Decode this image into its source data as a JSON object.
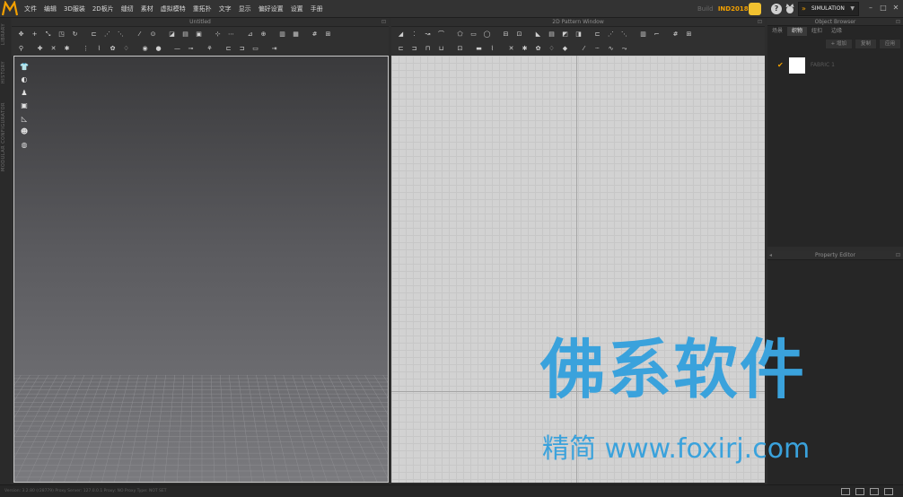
{
  "menubar": {
    "items": [
      "文件",
      "编辑",
      "3D服装",
      "2D板片",
      "缝纫",
      "素材",
      "虚拟模特",
      "重拓扑",
      "文字",
      "显示",
      "偏好设置",
      "设置",
      "手册"
    ],
    "build_label": "Build",
    "build_value": "IND2018",
    "mode": "SIMULATION",
    "help": "?"
  },
  "left_tabs": [
    "LIBRARY",
    "HISTORY",
    "MODULAR CONFIGURATOR"
  ],
  "window_3d": {
    "title": "Untitled"
  },
  "window_2d": {
    "title": "2D Pattern Window"
  },
  "object_browser": {
    "title": "Object Browser",
    "tabs": [
      "场景",
      "织物",
      "纽扣",
      "边缘"
    ],
    "active_tab": "织物",
    "actions": [
      "+ 增加",
      "复制",
      "应用"
    ],
    "fabric": {
      "name": "FABRIC 1",
      "swatch_color": "#ffffff"
    }
  },
  "property_editor": {
    "title": "Property Editor"
  },
  "statusbar": {
    "text": "Version: 3.2.80 (r28779)   Proxy Server: 127.0.0.1   Proxy: NO   Proxy Type: NOT SET"
  },
  "watermark": {
    "main": "佛系软件",
    "sub": "精简 www.foxirj.com"
  },
  "colors": {
    "accent": "#f2a000",
    "watermark": "#3aa2dc"
  }
}
